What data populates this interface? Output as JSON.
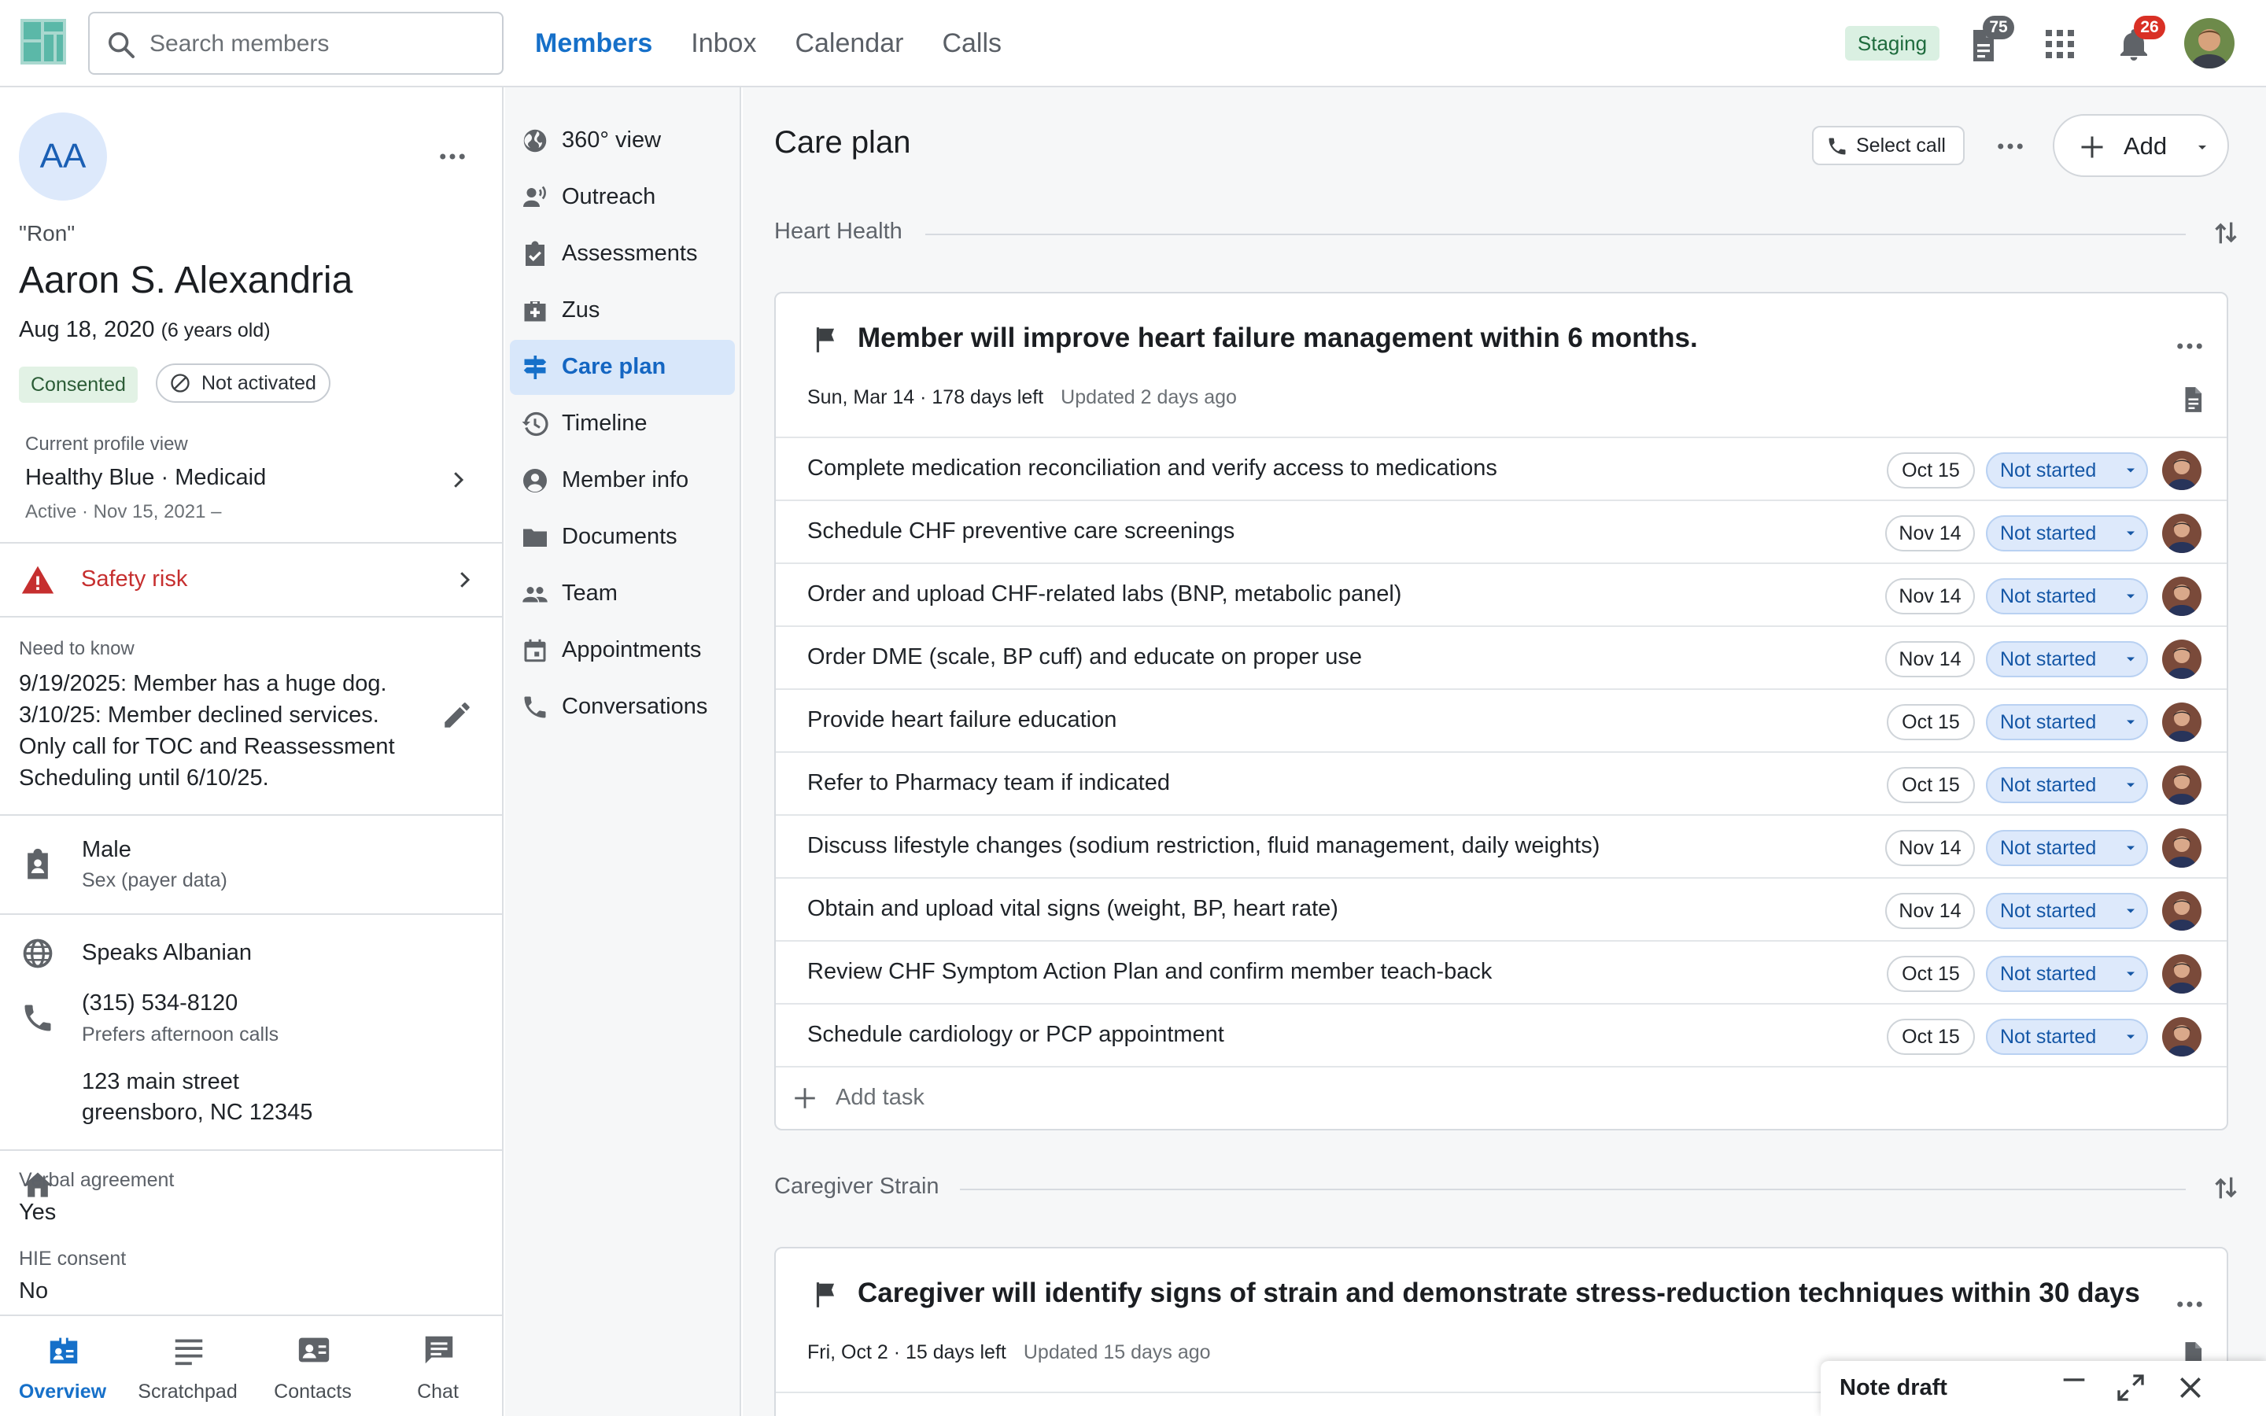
{
  "search": {
    "placeholder": "Search members"
  },
  "nav": [
    {
      "label": "Members",
      "active": true
    },
    {
      "label": "Inbox"
    },
    {
      "label": "Calendar"
    },
    {
      "label": "Calls"
    }
  ],
  "topbar": {
    "env_badge": "Staging",
    "docs_count": "75",
    "notifications_count": "26",
    "accent_color": "#1670c9",
    "alert_badge_color": "#d93025",
    "count_badge_color": "#5f6368"
  },
  "member": {
    "initials": "AA",
    "nickname": "\"Ron\"",
    "name": "Aaron S. Alexandria",
    "dob": "Aug 18, 2020",
    "age": "(6 years old)",
    "consent_badge": "Consented",
    "activation_badge": "Not activated",
    "profile_view_label": "Current profile view",
    "profile_view_value": "Healthy Blue · Medicaid",
    "profile_view_status": "Active · Nov 15, 2021 –",
    "safety_risk": "Safety risk",
    "need_to_know_label": "Need to know",
    "need_to_know_text": "9/19/2025: Member has a huge dog.\n3/10/25: Member declined services.\nOnly call for TOC and Reassessment\nScheduling until 6/10/25.",
    "sex": "Male",
    "sex_caption": "Sex (payer data)",
    "language": "Speaks Albanian",
    "phone": "(315) 534-8120",
    "phone_caption": "Prefers afternoon calls",
    "address_line1": "123 main street",
    "address_line2": "greensboro, NC 12345",
    "verbal_agreement_label": "Verbal agreement",
    "verbal_agreement_value": "Yes",
    "hie_consent_label": "HIE consent",
    "hie_consent_value": "No"
  },
  "bottom_tabs": [
    {
      "label": "Overview",
      "icon": "badge-icon",
      "active": true
    },
    {
      "label": "Scratchpad",
      "icon": "notes-icon"
    },
    {
      "label": "Contacts",
      "icon": "contacts-icon"
    },
    {
      "label": "Chat",
      "icon": "chat-icon"
    }
  ],
  "subnav": [
    {
      "label": "360° view",
      "icon": "globe-icon"
    },
    {
      "label": "Outreach",
      "icon": "outreach-icon"
    },
    {
      "label": "Assessments",
      "icon": "clipboard-check-icon"
    },
    {
      "label": "Zus",
      "icon": "medical-bag-icon"
    },
    {
      "label": "Care plan",
      "icon": "signpost-icon",
      "active": true
    },
    {
      "label": "Timeline",
      "icon": "history-icon"
    },
    {
      "label": "Member info",
      "icon": "person-circle-icon"
    },
    {
      "label": "Documents",
      "icon": "folder-icon"
    },
    {
      "label": "Team",
      "icon": "group-icon"
    },
    {
      "label": "Appointments",
      "icon": "calendar-icon"
    },
    {
      "label": "Conversations",
      "icon": "phone-icon"
    }
  ],
  "main": {
    "title": "Care plan",
    "select_call": "Select call",
    "add_label": "Add",
    "add_task_label": "Add task",
    "sections": [
      {
        "name": "Heart Health",
        "goal": {
          "title": "Member will improve heart failure management within 6 months.",
          "meta": "Sun, Mar 14 · 178 days left",
          "updated": "Updated 2 days ago"
        },
        "tasks": [
          {
            "title": "Complete medication reconciliation and verify access to medications",
            "due": "Oct 15",
            "status": "Not started"
          },
          {
            "title": "Schedule CHF preventive care screenings",
            "due": "Nov 14",
            "status": "Not started"
          },
          {
            "title": "Order and upload CHF-related labs (BNP, metabolic panel)",
            "due": "Nov 14",
            "status": "Not started"
          },
          {
            "title": "Order DME (scale, BP cuff) and educate on proper use",
            "due": "Nov 14",
            "status": "Not started"
          },
          {
            "title": "Provide heart failure education",
            "due": "Oct 15",
            "status": "Not started"
          },
          {
            "title": "Refer to Pharmacy team if indicated",
            "due": "Oct 15",
            "status": "Not started"
          },
          {
            "title": "Discuss lifestyle changes (sodium restriction, fluid management, daily weights)",
            "due": "Nov 14",
            "status": "Not started"
          },
          {
            "title": "Obtain and upload vital signs (weight, BP, heart rate)",
            "due": "Nov 14",
            "status": "Not started"
          },
          {
            "title": "Review CHF Symptom Action Plan and confirm member teach-back",
            "due": "Oct 15",
            "status": "Not started"
          },
          {
            "title": "Schedule cardiology or PCP appointment",
            "due": "Oct 15",
            "status": "Not started"
          }
        ]
      },
      {
        "name": "Caregiver Strain",
        "goal": {
          "title": "Caregiver will identify signs of strain and demonstrate stress-reduction techniques within 30 days",
          "meta": "Fri, Oct 2 · 15 days left",
          "updated": "Updated 15 days ago"
        },
        "tasks": []
      }
    ]
  },
  "note_draft": {
    "label": "Note draft"
  }
}
